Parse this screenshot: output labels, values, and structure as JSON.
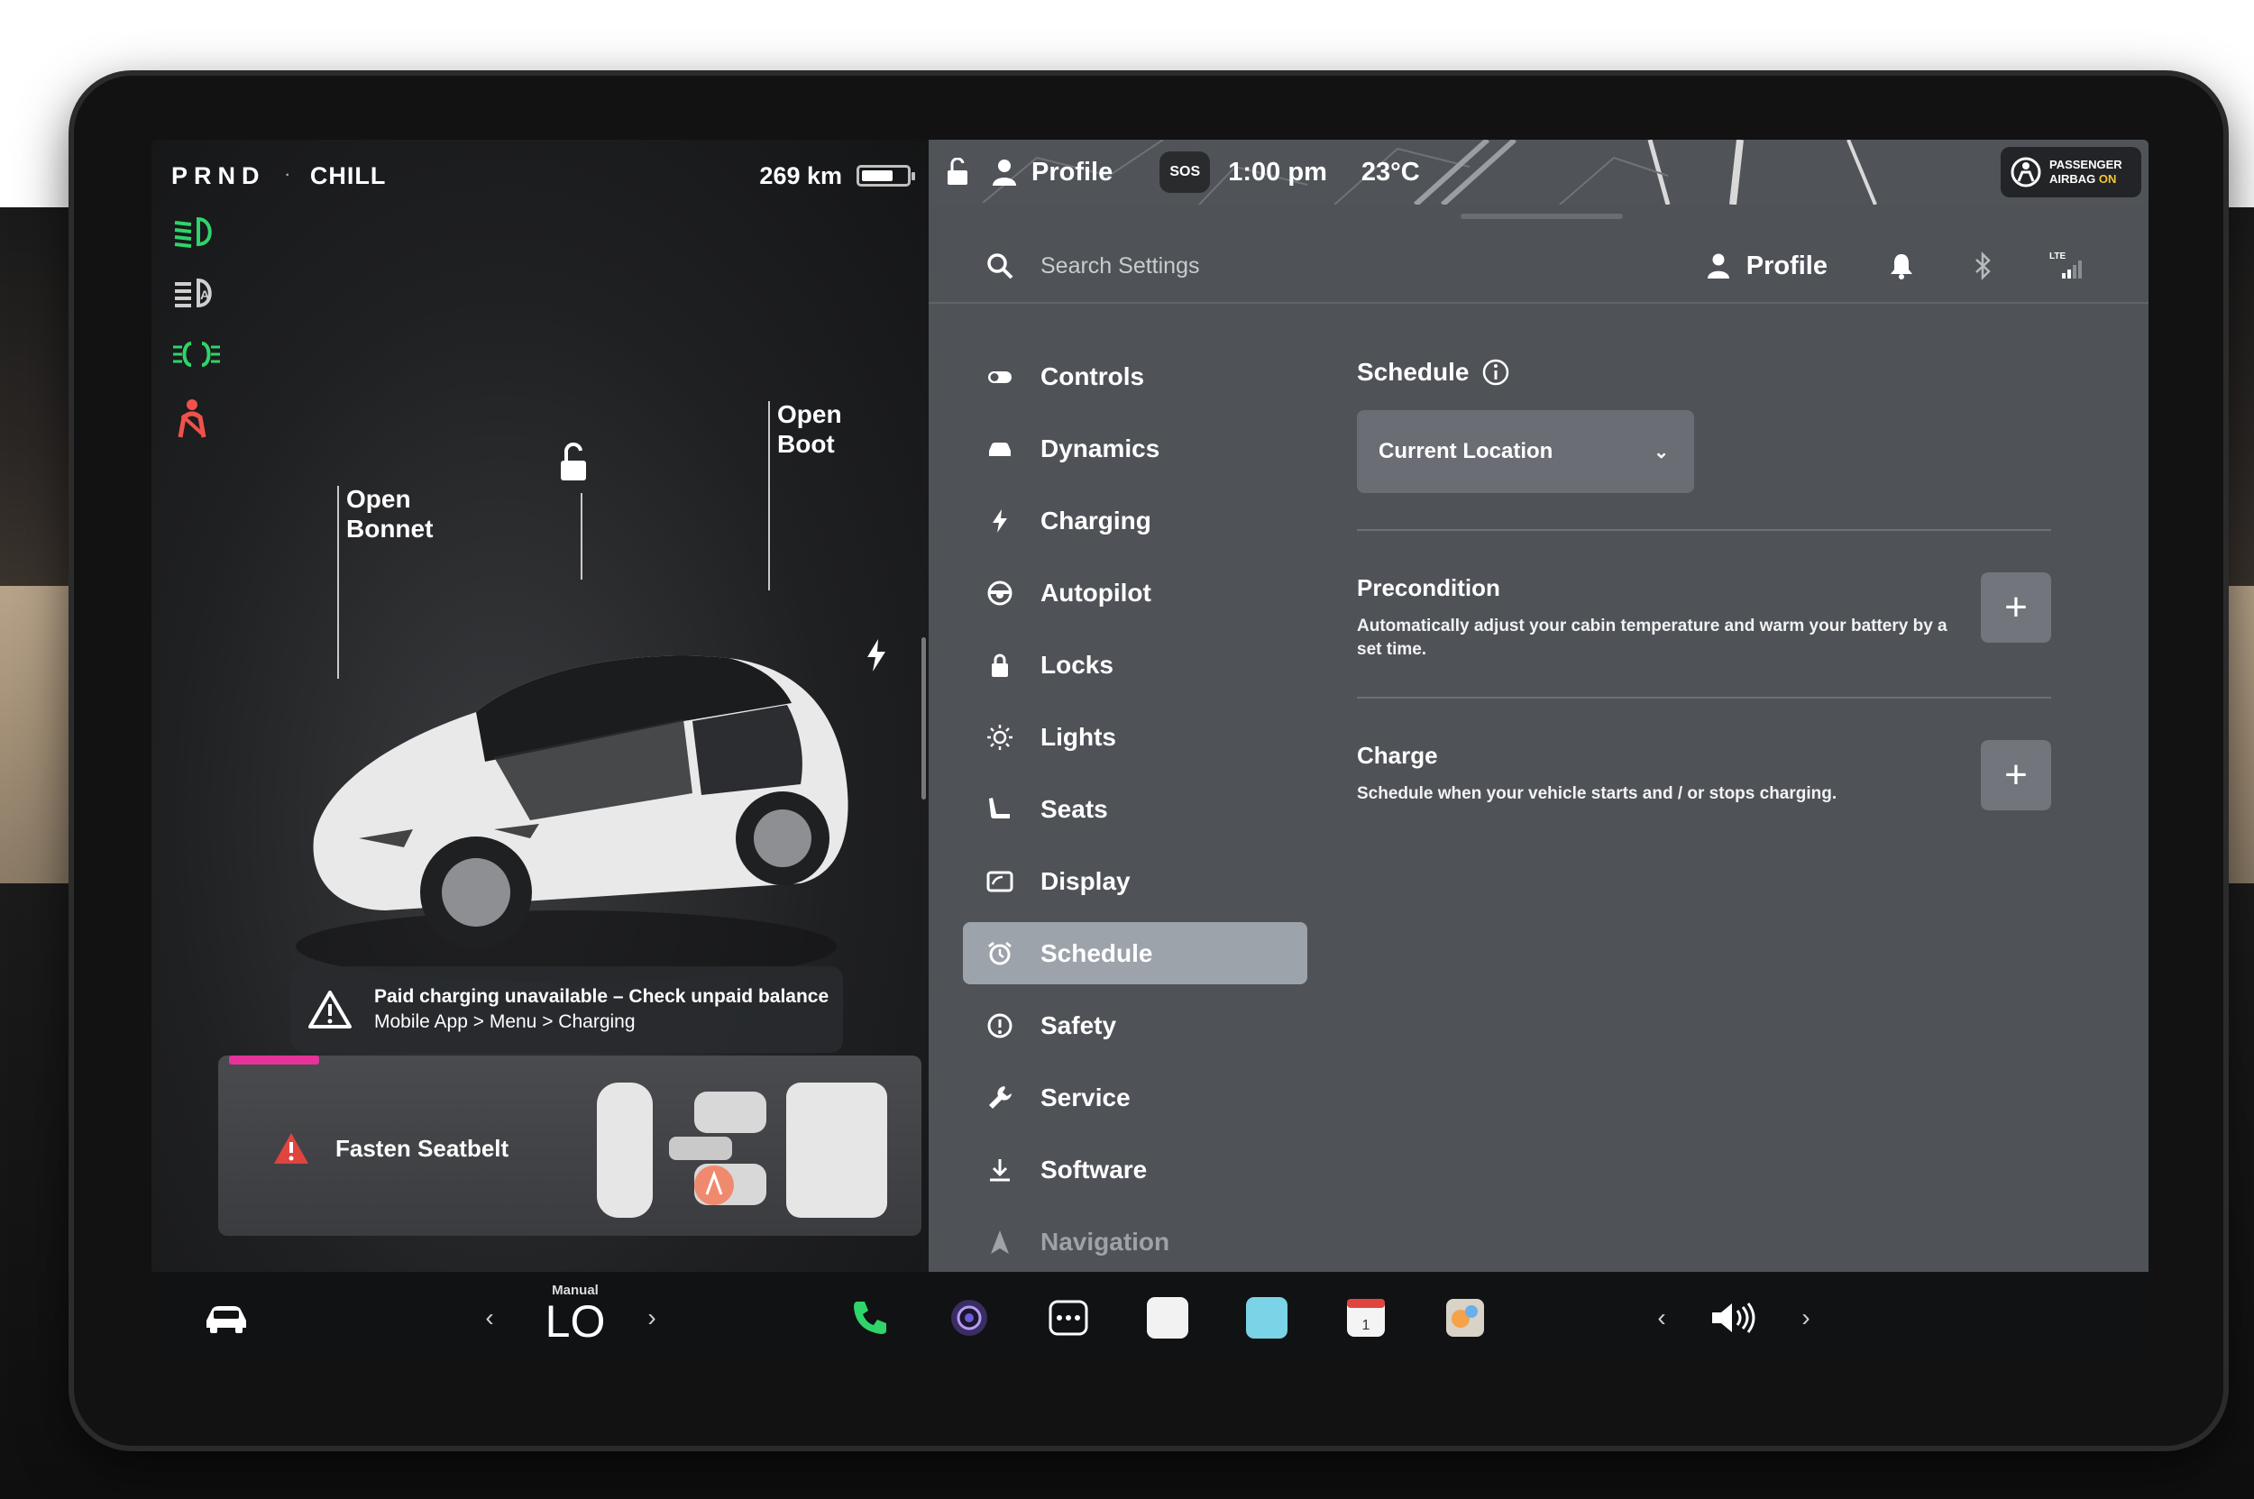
{
  "left": {
    "gear": "PRND",
    "separator": "·",
    "drive_mode": "CHILL",
    "range": "269 km",
    "battery_level": 0.7,
    "labels": {
      "bonnet_line1": "Open",
      "bonnet_line2": "Bonnet",
      "boot_line1": "Open",
      "boot_line2": "Boot"
    },
    "alert": {
      "title": "Paid charging unavailable – Check unpaid balance",
      "subtitle": "Mobile App > Menu > Charging"
    },
    "seatbelt_warning": "Fasten Seatbelt"
  },
  "top_status": {
    "profile": "Profile",
    "sos": "SOS",
    "time": "1:00 pm",
    "temperature": "23°C",
    "airbag_line1": "PASSENGER",
    "airbag_line2_a": "AIRBAG",
    "airbag_line2_b": "ON"
  },
  "settings": {
    "search_placeholder": "Search Settings",
    "profile_label": "Profile",
    "lte_label": "LTE",
    "menu": [
      {
        "label": "Controls",
        "icon": "toggle-icon"
      },
      {
        "label": "Dynamics",
        "icon": "car-icon"
      },
      {
        "label": "Charging",
        "icon": "bolt-icon"
      },
      {
        "label": "Autopilot",
        "icon": "steering-wheel-icon"
      },
      {
        "label": "Locks",
        "icon": "lock-icon"
      },
      {
        "label": "Lights",
        "icon": "sun-icon"
      },
      {
        "label": "Seats",
        "icon": "seat-icon"
      },
      {
        "label": "Display",
        "icon": "display-icon"
      },
      {
        "label": "Schedule",
        "icon": "alarm-clock-icon"
      },
      {
        "label": "Safety",
        "icon": "alert-circle-icon"
      },
      {
        "label": "Service",
        "icon": "wrench-icon"
      },
      {
        "label": "Software",
        "icon": "download-icon"
      },
      {
        "label": "Navigation",
        "icon": "navigation-arrow-icon"
      }
    ],
    "active_item": "Schedule",
    "schedule": {
      "title": "Schedule",
      "location": "Current Location",
      "precondition": {
        "title": "Precondition",
        "description": "Automatically adjust your cabin temperature and warm your battery by a set time."
      },
      "charge": {
        "title": "Charge",
        "description": "Schedule when your vehicle starts and / or stops charging."
      },
      "add_label": "+"
    }
  },
  "dock": {
    "climate_mode": "Manual",
    "climate_value": "LO",
    "left_arrow": "‹",
    "right_arrow": "›"
  },
  "colors": {
    "accent_green": "#2fd46a",
    "warning_red": "#f0514b",
    "pink_accent": "#e6339a",
    "airbag_yellow": "#f7c531",
    "active_menu": "#9ca3ab"
  }
}
